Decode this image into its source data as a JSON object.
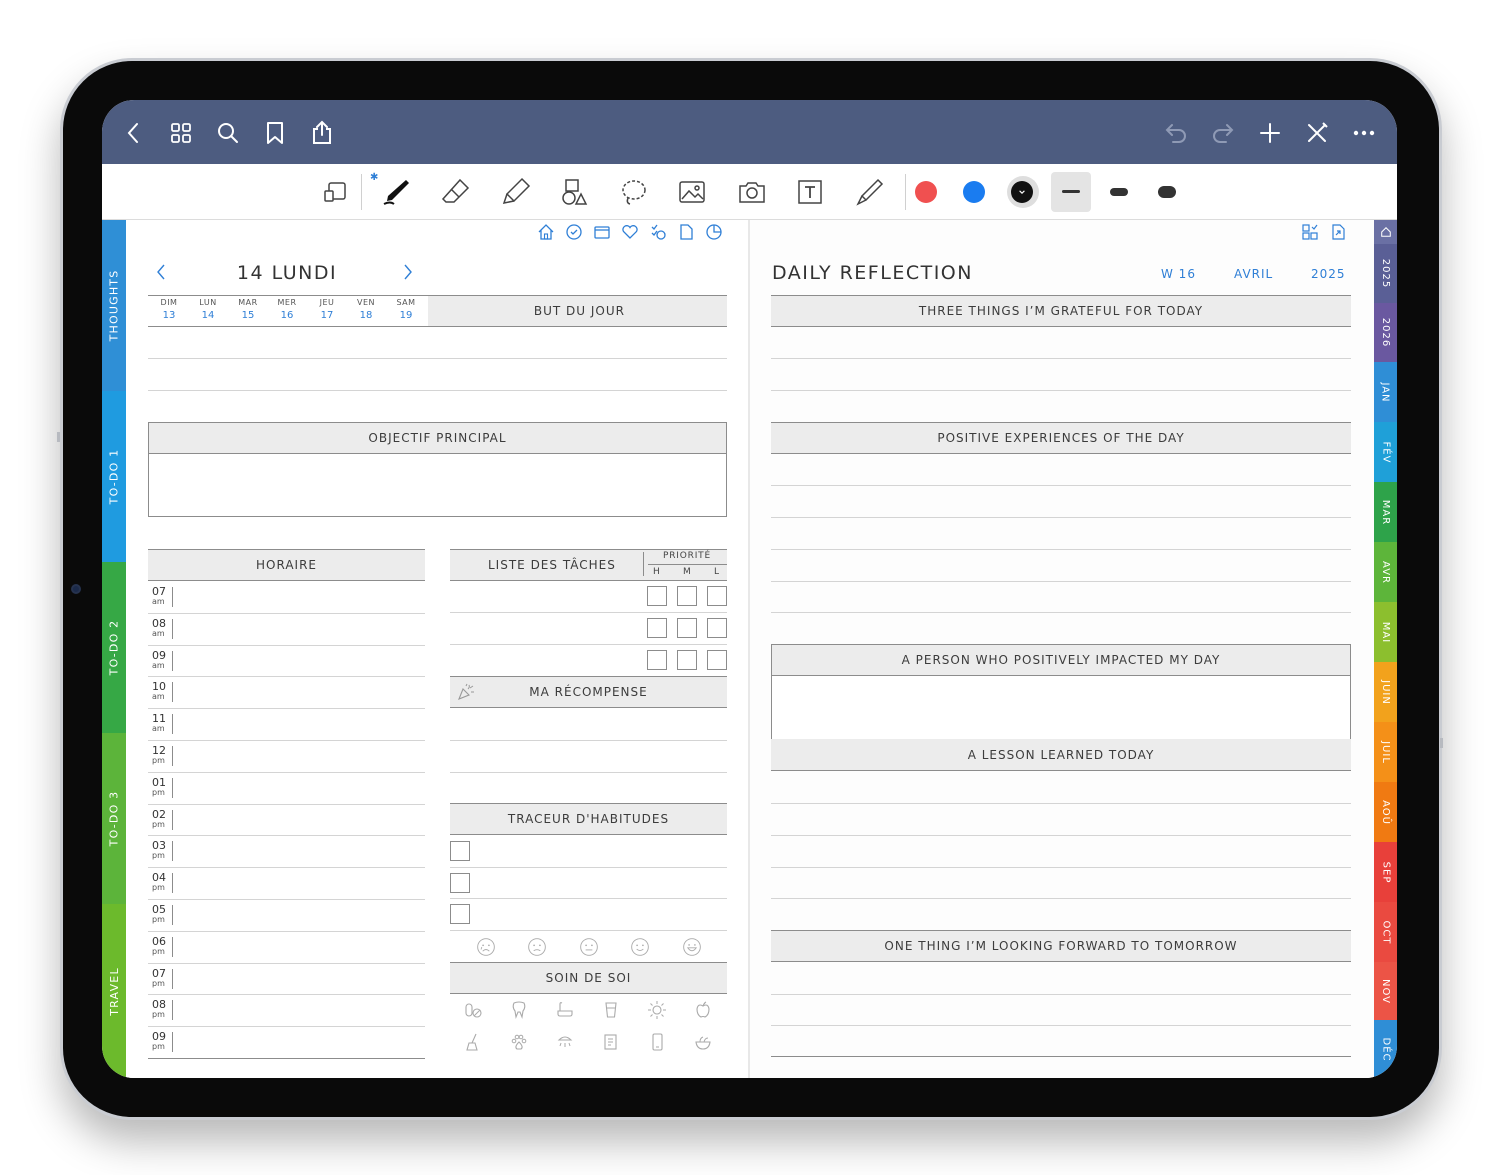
{
  "app": {
    "topbar_icons": [
      "back-icon",
      "grid-icon",
      "search-icon",
      "bookmark-icon",
      "share-icon",
      "undo-icon",
      "redo-icon",
      "add-icon",
      "close-pen-icon",
      "more-icon"
    ],
    "tools": [
      "lasso-note-icon",
      "pen-icon",
      "eraser-icon",
      "highlighter-icon",
      "shapes-icon",
      "lasso-icon",
      "image-icon",
      "camera-icon",
      "text-icon",
      "laser-icon"
    ],
    "colors": {
      "red": "#f05050",
      "blue": "#1a7cf0",
      "black": "#111111",
      "topbar": "#4d5c80"
    }
  },
  "left_tabs": [
    {
      "label": "THOUGHTS",
      "color": "#2f8fd6"
    },
    {
      "label": "TO-DO 1",
      "color": "#1f9be0"
    },
    {
      "label": "TO-DO 2",
      "color": "#36a845"
    },
    {
      "label": "TO-DO 3",
      "color": "#5cb43a"
    },
    {
      "label": "TRAVEL",
      "color": "#6cba2c"
    }
  ],
  "right_tabs": [
    {
      "label": "2025",
      "color": "#5a5f96"
    },
    {
      "label": "2026",
      "color": "#6a58a0"
    },
    {
      "label": "JAN",
      "color": "#2f8ed6"
    },
    {
      "label": "FÉV",
      "color": "#1fa0d8"
    },
    {
      "label": "MAR",
      "color": "#2ea34a"
    },
    {
      "label": "AVR",
      "color": "#5db53a"
    },
    {
      "label": "MAI",
      "color": "#8cbf2e"
    },
    {
      "label": "JUIN",
      "color": "#f2a21c"
    },
    {
      "label": "JUIL",
      "color": "#f49018"
    },
    {
      "label": "AOÛ",
      "color": "#f07a12"
    },
    {
      "label": "SEP",
      "color": "#e8403a"
    },
    {
      "label": "OCT",
      "color": "#ea4a40"
    },
    {
      "label": "NOV",
      "color": "#ec5446"
    },
    {
      "label": "DÉC",
      "color": "#2f8ed6"
    }
  ],
  "left_page": {
    "nav_icons": [
      "home-icon",
      "refresh-icon",
      "folder-icon",
      "heart-icon",
      "todo-icon",
      "note-icon",
      "chart-icon"
    ],
    "date_title": "14 LUNDI",
    "days": [
      {
        "name": "DIM",
        "num": "13"
      },
      {
        "name": "LUN",
        "num": "14"
      },
      {
        "name": "MAR",
        "num": "15"
      },
      {
        "name": "MER",
        "num": "16"
      },
      {
        "name": "JEU",
        "num": "17"
      },
      {
        "name": "VEN",
        "num": "18"
      },
      {
        "name": "SAM",
        "num": "19"
      }
    ],
    "goal_header": "BUT DU JOUR",
    "main_objective": "OBJECTIF PRINCIPAL",
    "schedule_header": "HORAIRE",
    "hours": [
      {
        "h": "07",
        "p": "am"
      },
      {
        "h": "08",
        "p": "am"
      },
      {
        "h": "09",
        "p": "am"
      },
      {
        "h": "10",
        "p": "am"
      },
      {
        "h": "11",
        "p": "am"
      },
      {
        "h": "12",
        "p": "pm"
      },
      {
        "h": "01",
        "p": "pm"
      },
      {
        "h": "02",
        "p": "pm"
      },
      {
        "h": "03",
        "p": "pm"
      },
      {
        "h": "04",
        "p": "pm"
      },
      {
        "h": "05",
        "p": "pm"
      },
      {
        "h": "06",
        "p": "pm"
      },
      {
        "h": "07",
        "p": "pm"
      },
      {
        "h": "08",
        "p": "pm"
      },
      {
        "h": "09",
        "p": "pm"
      }
    ],
    "tasks_header": "LISTE DES TÂCHES",
    "priority_label": "PRIORITÉ",
    "priority_levels": [
      "H",
      "M",
      "L"
    ],
    "reward_header": "MA RÉCOMPENSE",
    "habits_header": "TRACEUR D'HABITUDES",
    "mood_icons": [
      "sad-icon",
      "frown-icon",
      "neutral-icon",
      "smile-icon",
      "happy-icon"
    ],
    "selfcare_header": "SOIN DE SOI",
    "selfcare_icons": [
      "pills-icon",
      "tooth-icon",
      "bath-icon",
      "water-glass-icon",
      "sun-icon",
      "apple-icon",
      "cleaning-icon",
      "paw-icon",
      "shower-icon",
      "journal-icon",
      "phone-icon",
      "salad-icon"
    ]
  },
  "right_page": {
    "nav_icons": [
      "layout-icon",
      "export-icon"
    ],
    "title": "DAILY REFLECTION",
    "week": "W 16",
    "month": "AVRIL",
    "year": "2025",
    "sections": {
      "grateful": "THREE THINGS I’M GRATEFUL FOR TODAY",
      "positive": "POSITIVE EXPERIENCES OF THE DAY",
      "person": "A PERSON WHO POSITIVELY IMPACTED MY DAY",
      "lesson": "A LESSON LEARNED TODAY",
      "forward": "ONE THING I’M LOOKING FORWARD TO TOMORROW"
    }
  }
}
